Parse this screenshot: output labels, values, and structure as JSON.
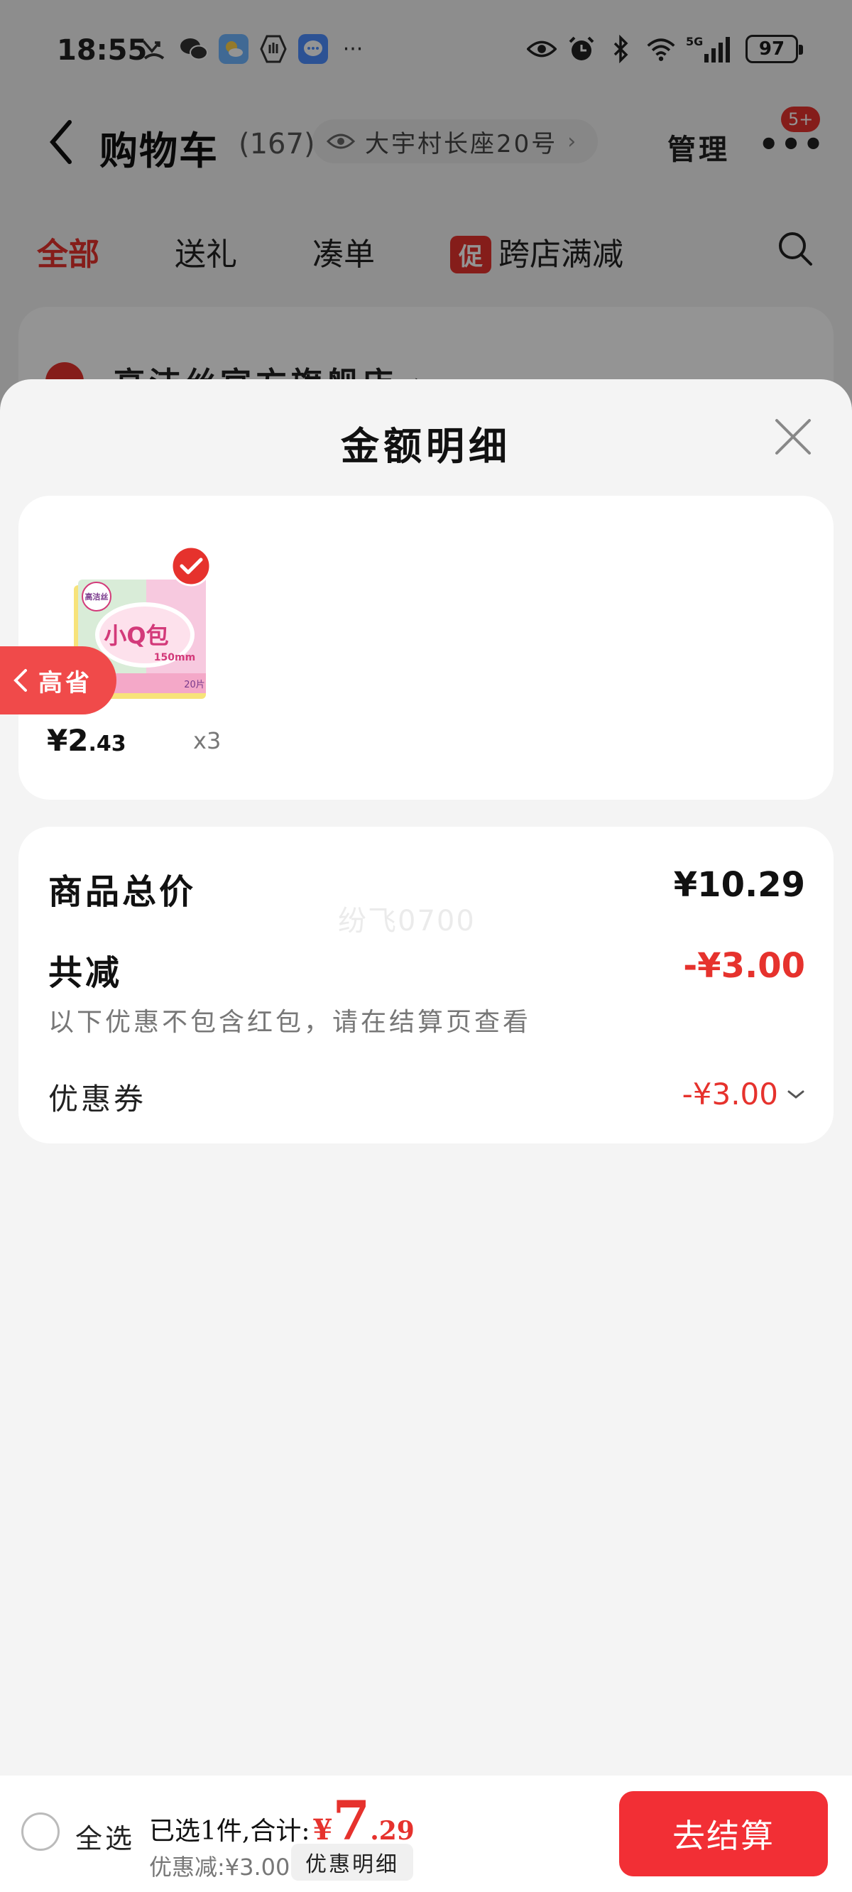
{
  "status_bar": {
    "time": "18:55",
    "battery": "97",
    "network": "5G"
  },
  "nav": {
    "title": "购物车",
    "count": "(167)",
    "address": "大宇村长座20号",
    "manage": "管理",
    "badge": "5+"
  },
  "tabs": [
    {
      "label": "全部",
      "active": true
    },
    {
      "label": "送礼"
    },
    {
      "label": "凑单"
    },
    {
      "label": "跨店满减",
      "badge": "促"
    }
  ],
  "store": {
    "name": "高洁丝官方旗舰店 ›"
  },
  "sheet": {
    "title": "金额明细",
    "product": {
      "image_text_brand": "高洁丝",
      "image_text_name": "小Q包",
      "image_text_size": "150mm",
      "image_text_count": "20片",
      "price_yen": "¥2",
      "price_decimal": ".43",
      "qty": "x3"
    },
    "side_tab_label": "高省",
    "summary": {
      "total_label": "商品总价",
      "total_value": "¥10.29",
      "reduce_label": "共减",
      "reduce_value": "-¥3.00",
      "note": "以下优惠不包含红包，请在结算页查看",
      "coupon_label": "优惠券",
      "coupon_value": "-¥3.00",
      "watermark": "纷飞0700"
    }
  },
  "bottom_bar": {
    "select_all": "全选",
    "selected_text": "已选1件,合计:",
    "yen": "¥",
    "total_int": "7",
    "total_dec": ".29",
    "discount_text": "优惠减:¥3.00",
    "detail_button": "优惠明细",
    "checkout": "去结算"
  },
  "colors": {
    "accent": "#e6322d",
    "checkout": "#f22f35",
    "side_tab": "#f04a4a",
    "sheet_bg": "#f4f4f4"
  },
  "icons": {
    "back": "chevron-left-icon",
    "eye": "eye-icon",
    "close": "close-icon",
    "search": "search-icon",
    "check": "check-icon"
  }
}
